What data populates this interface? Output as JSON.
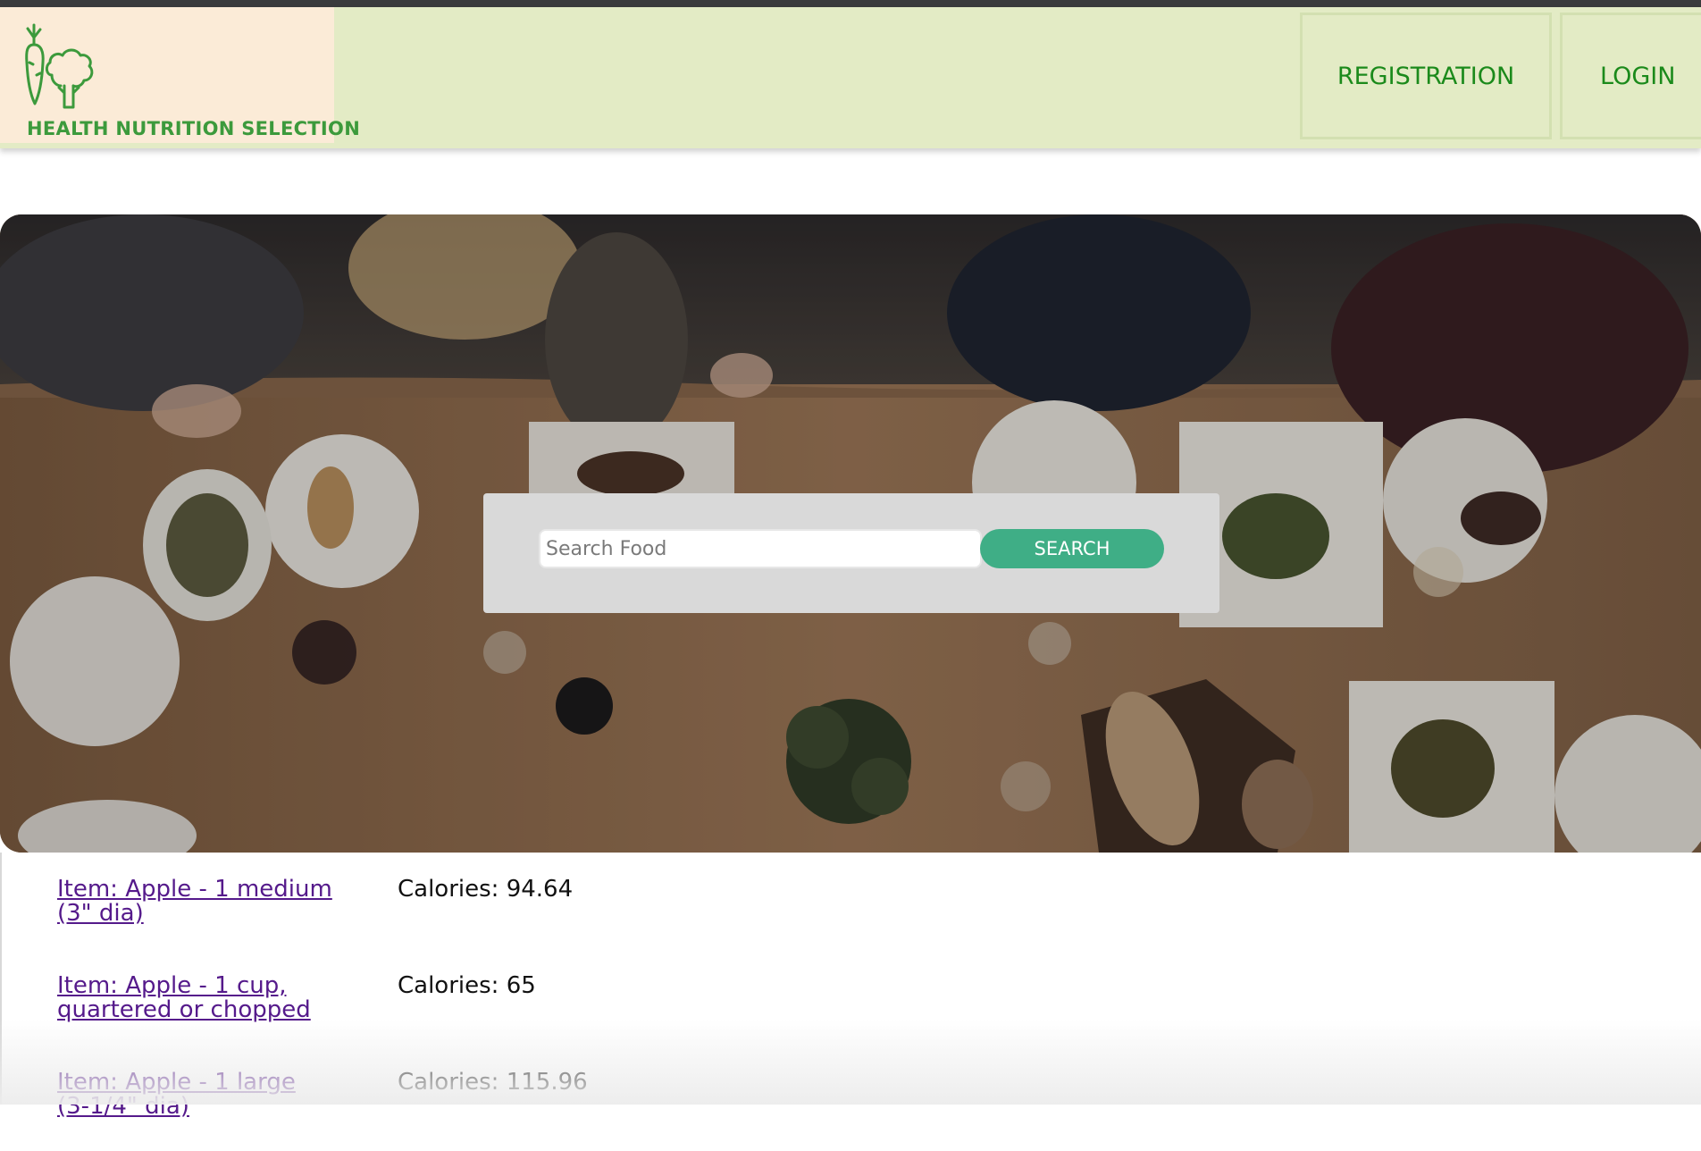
{
  "header": {
    "brand": "HEALTH NUTRITION SELECTION",
    "nav": {
      "registration": "REGISTRATION",
      "login": "LOGIN"
    }
  },
  "search": {
    "placeholder": "Search Food",
    "value": "",
    "button_label": "SEARCH"
  },
  "results": [
    {
      "item": "Item: Apple - 1 medium (3\" dia)",
      "calories": "Calories: 94.64"
    },
    {
      "item": "Item: Apple - 1 cup, quartered or chopped",
      "calories": "Calories: 65"
    },
    {
      "item": "Item: Apple - 1 large (3-1/4\" dia)",
      "calories": "Calories: 115.96"
    }
  ],
  "colors": {
    "header_bg": "#e3ebc5",
    "logo_bg": "#fbebd7",
    "brand_green": "#3c9a3c",
    "nav_text": "#1b8a1b",
    "search_button": "#3fae86",
    "link_visited": "#551a8b"
  },
  "icons": [
    "carrot-icon",
    "broccoli-icon"
  ]
}
